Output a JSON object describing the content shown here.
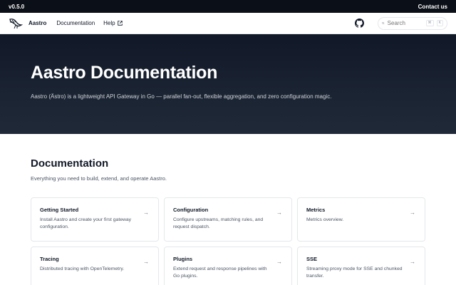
{
  "topbar": {
    "version": "v0.5.0",
    "contact": "Contact us"
  },
  "nav": {
    "brand": "Aastro",
    "links": [
      {
        "label": "Documentation"
      },
      {
        "label": "Help"
      }
    ],
    "search": {
      "placeholder": "Search",
      "shortcut_mod": "⌘",
      "shortcut_key": "K"
    }
  },
  "hero": {
    "title": "Aastro Documentation",
    "subtitle": "Aastro (Ästro) is a lightweight API Gateway in Go — parallel fan-out, flexible aggregation, and zero configuration magic."
  },
  "section": {
    "title": "Documentation",
    "subtitle": "Everything you need to build, extend, and operate Aastro."
  },
  "cards": [
    {
      "title": "Getting Started",
      "desc": "Install Aastro and create your first gateway configuration.",
      "arrow": "→"
    },
    {
      "title": "Configuration",
      "desc": "Configure upstreams, matching rules, and request dispatch.",
      "arrow": "→"
    },
    {
      "title": "Metrics",
      "desc": "Metrics overview.",
      "arrow": "→"
    },
    {
      "title": "Tracing",
      "desc": "Distributed tracing with OpenTelemetry.",
      "arrow": "→"
    },
    {
      "title": "Plugins",
      "desc": "Extend request and response pipelines with Go plugins.",
      "arrow": "→"
    },
    {
      "title": "SSE",
      "desc": "Streaming proxy mode for SSE and chunked transfer.",
      "arrow": "→"
    }
  ],
  "colors": {
    "hero_bg": "#111827",
    "topbar_bg": "#0b0f17",
    "border": "#e5e7eb"
  },
  "icons": {
    "logo": "bird-logo-icon",
    "external": "external-link-icon",
    "github": "github-icon",
    "search": "search-icon"
  }
}
